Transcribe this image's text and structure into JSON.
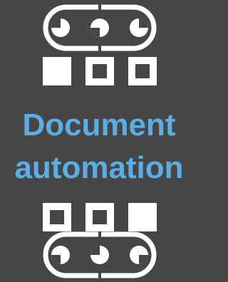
{
  "tile": {
    "title_line1": "Document",
    "title_line2": "automation",
    "accent_color": "#5aaee6",
    "background_color": "#464646",
    "icon_color": "#ffffff"
  },
  "icons": {
    "top": "conveyor-belt-icon",
    "bottom": "conveyor-belt-icon",
    "documents_top": "document-boxes-icon",
    "documents_bottom": "document-boxes-icon"
  }
}
